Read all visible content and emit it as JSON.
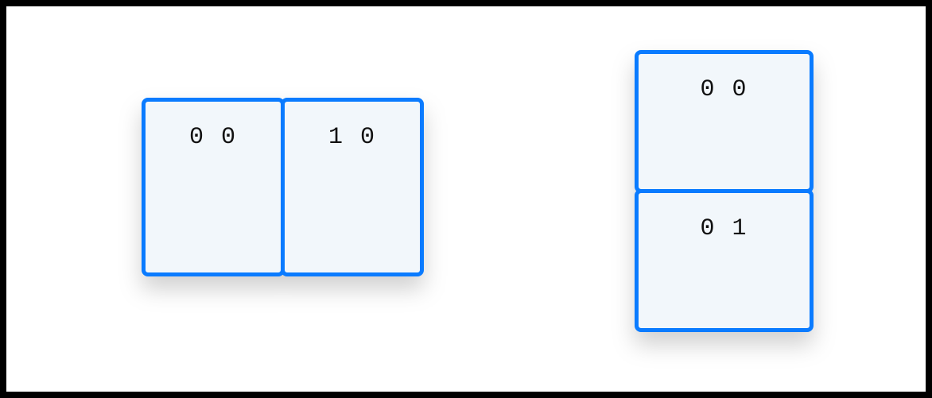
{
  "colors": {
    "cell_border": "#0a7bff",
    "cell_background": "#f2f7fb",
    "canvas_background": "#ffffff",
    "frame_background": "#000000"
  },
  "groups": {
    "horizontal": {
      "orientation": "row",
      "cells": [
        {
          "label": "0 0"
        },
        {
          "label": "1 0"
        }
      ]
    },
    "vertical": {
      "orientation": "column",
      "cells": [
        {
          "label": "0 0"
        },
        {
          "label": "0 1"
        }
      ]
    }
  }
}
